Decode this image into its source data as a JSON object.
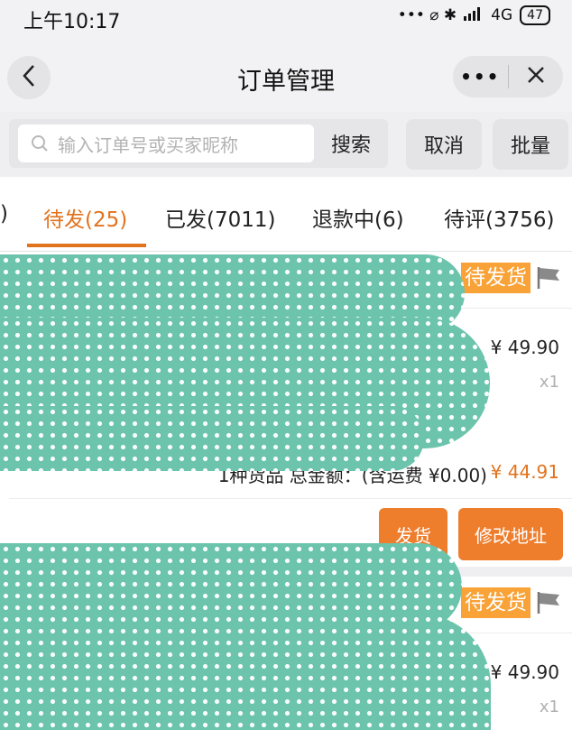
{
  "status_bar": {
    "time": "上午10:17",
    "indicators": "••• ⌀ ✱",
    "network": "4G",
    "battery": "47"
  },
  "nav": {
    "title": "订单管理",
    "more": "•••"
  },
  "search": {
    "placeholder": "输入订单号或买家昵称",
    "button": "搜索",
    "cancel": "取消",
    "batch": "批量"
  },
  "tabs": [
    {
      "label": ")"
    },
    {
      "label": "待发(25)"
    },
    {
      "label": "已发(7011)"
    },
    {
      "label": "退款中(6)"
    },
    {
      "label": "待评(3756)"
    }
  ],
  "orders": [
    {
      "status": "待发货",
      "price": "¥ 49.90",
      "qty": "x1",
      "summary_text": "1种货品 总金额：(含运费 ¥0.00)",
      "summary_total": "¥ 44.91",
      "ship_button": "发货",
      "edit_address_button": "修改地址"
    },
    {
      "status": "待发货",
      "price": "¥ 49.90",
      "qty": "x1"
    }
  ],
  "colors": {
    "accent": "#e2731e",
    "button_orange": "#ee7d2c",
    "status_badge": "#f8a237",
    "redaction": "#6cc4ad"
  }
}
